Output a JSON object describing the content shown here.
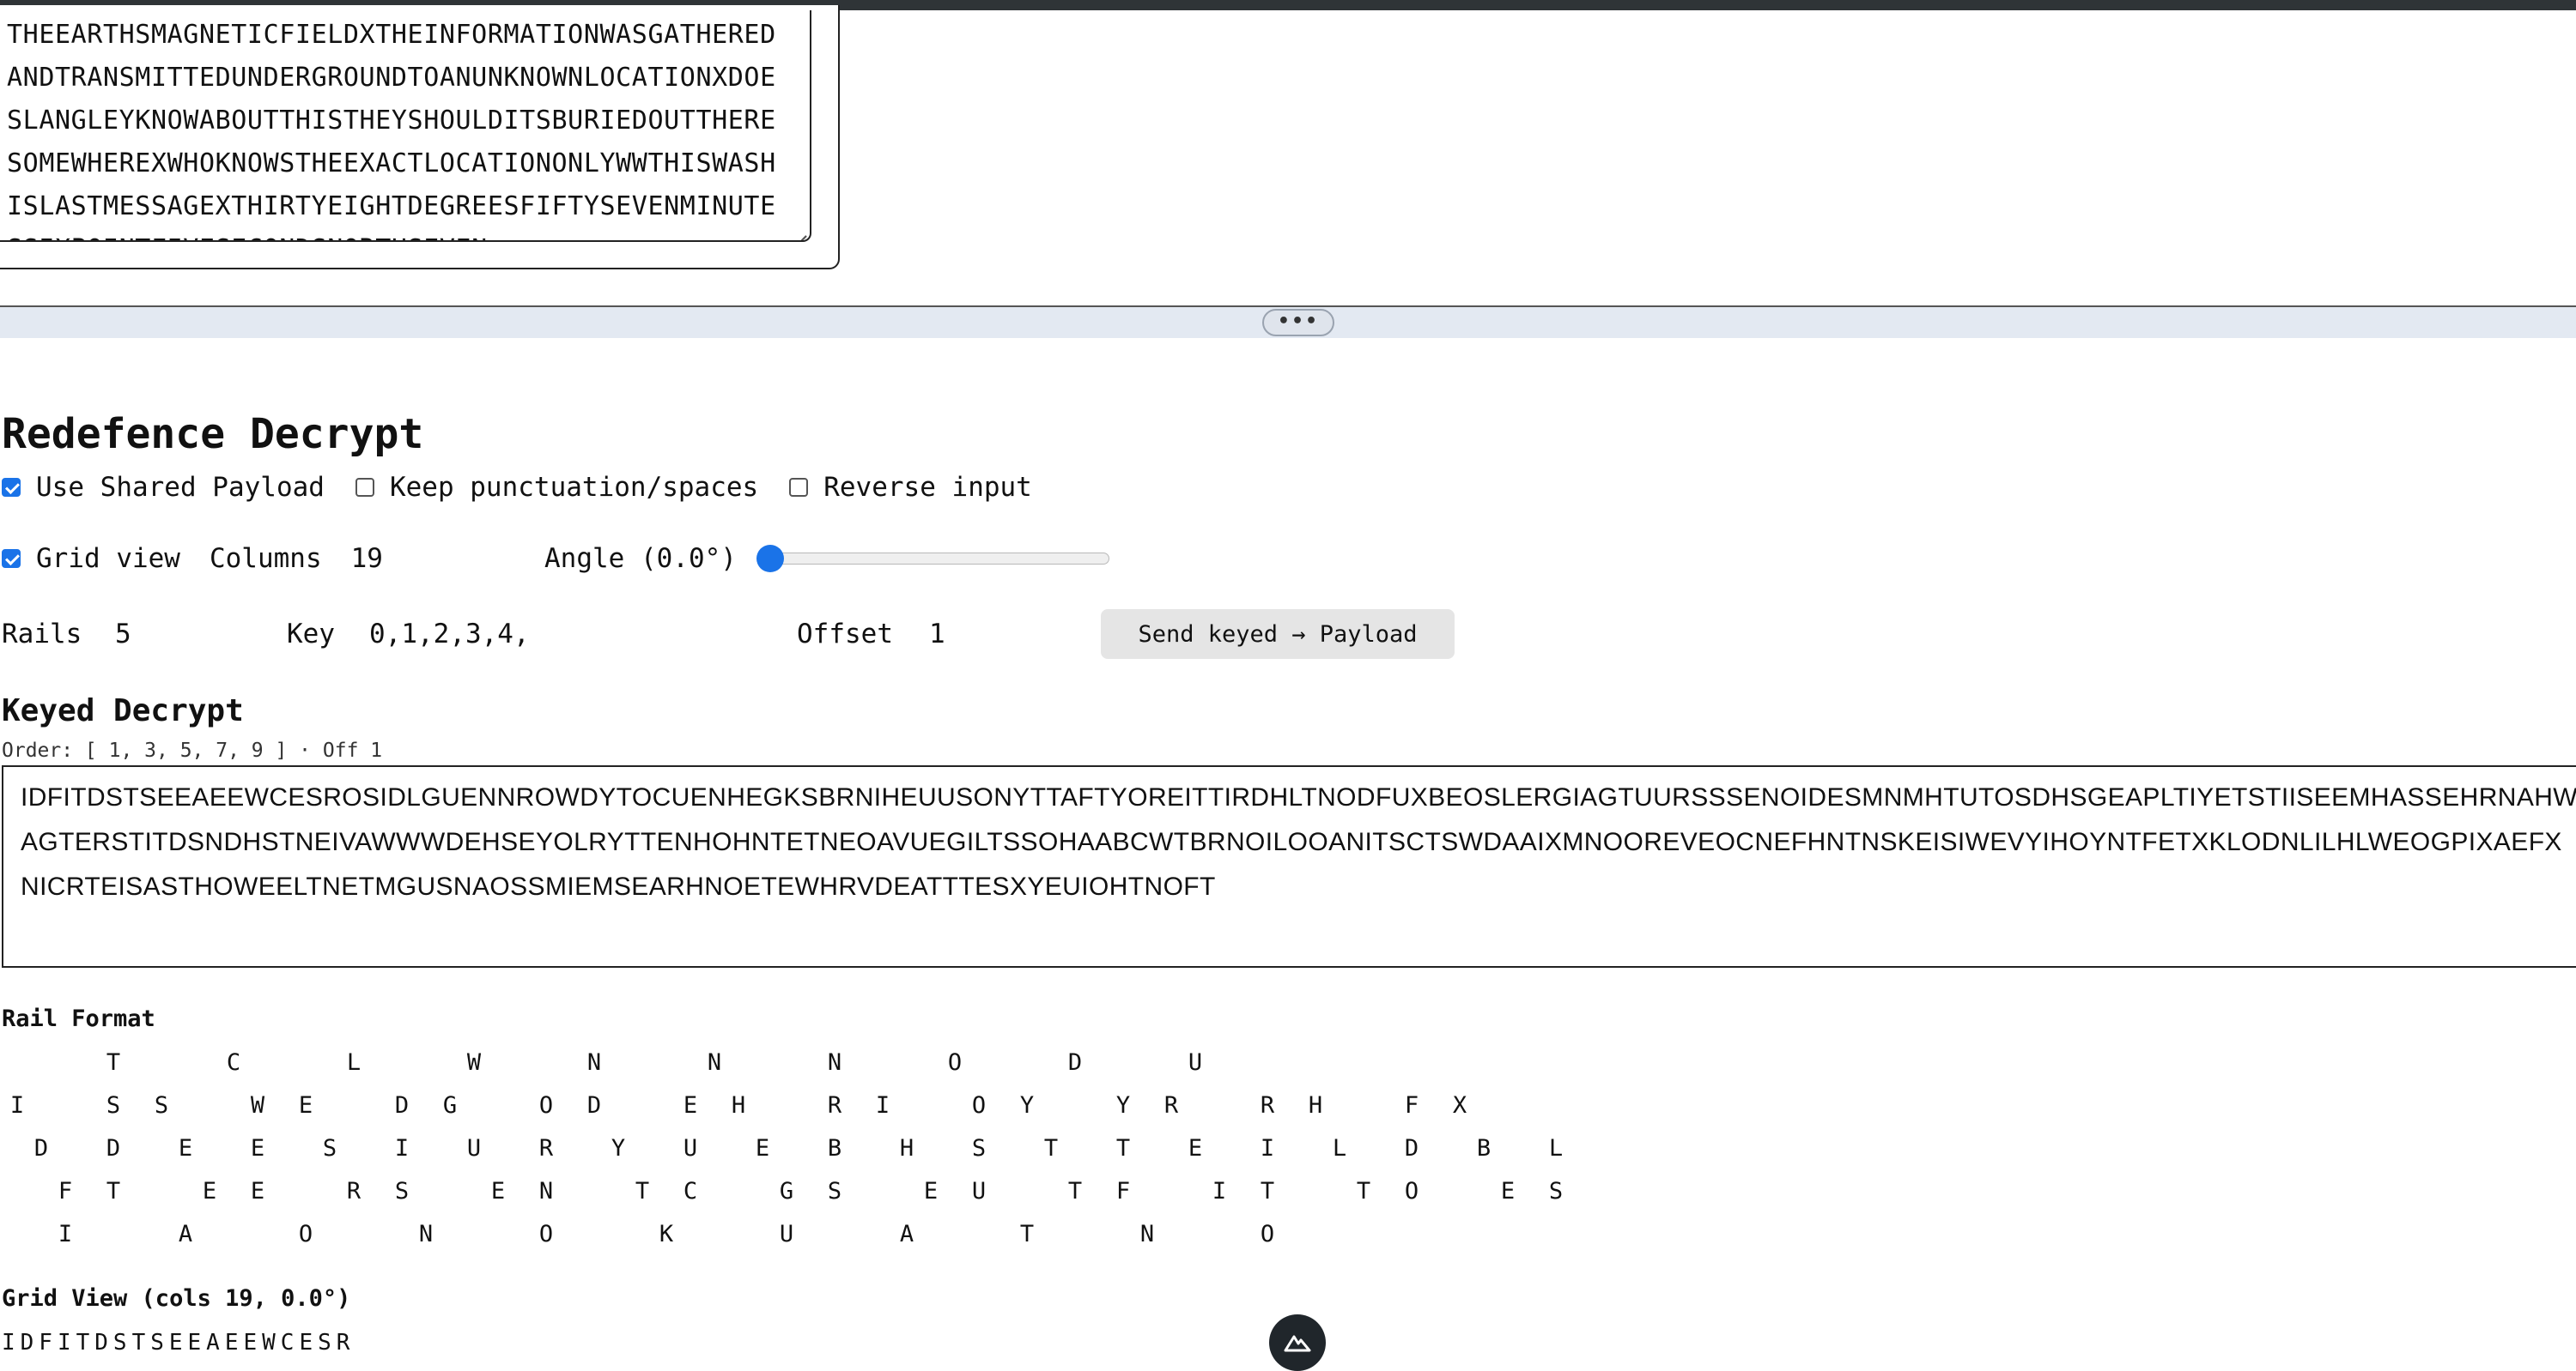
{
  "top_textarea": {
    "text": "THEEARTHSMAGNETICFIELDXTHEINFORMATIONWASGATHEREDANDTRANSMITTEDUNDERGROUNDTOANUNKNOWNLOCATIONXDOESLANGLEYKNOWABOUTTHISTHEYSHOULDITSBURIEDOUTTHERESOMEWHEREXWHOKNOWSTHEEXACTLOCATIONONLYWWTHISWASHISLASTMESSAGEXTHIRTYEIGHTDEGREESFIFTYSEVENMINUTESSIXPOINTFIVESECONDSNORTHSEVEN"
  },
  "splitter": {
    "grip": "•••"
  },
  "panel": {
    "title": "Redefence Decrypt",
    "options": {
      "use_shared_payload": {
        "label": "Use Shared Payload",
        "checked": true
      },
      "keep_punctuation": {
        "label": "Keep punctuation/spaces",
        "checked": false
      },
      "reverse_input": {
        "label": "Reverse input",
        "checked": false
      }
    },
    "grid_view": {
      "label": "Grid view",
      "checked": true
    },
    "columns": {
      "label": "Columns",
      "value": "19"
    },
    "angle": {
      "label": "Angle (0.0°)",
      "value": 0
    },
    "rails": {
      "label": "Rails",
      "value": "5"
    },
    "key": {
      "label": "Key",
      "value": "0,1,2,3,4,"
    },
    "offset": {
      "label": "Offset",
      "value": "1"
    },
    "send_button": "Send keyed → Payload"
  },
  "keyed": {
    "title": "Keyed Decrypt",
    "order": "Order: [ 1, 3, 5, 7, 9 ] · Off 1",
    "output": "IDFITDSTSEEAEEWCESROSIDLGUENNROWDYTOCUENHEGKSBRNIHEUUSONYTTAFTYOREITTIRDHLTNODFUXBEOSLERGIAGTUURSSSENOIDESMNMHTUTOSDHSGEAPLTIYETSTIISEEMHASSEHRNAHWAGTERSTITDSNDHSTNEIVAWWWDEHSEYOLRYTTENHOHNTETNEOAVUEGILTSSOHAABCWTBRNOILOOANITSCTSWDAAIXMNOOREVEOCNEFHNTNSKEISIWEVYIHOYNTFETXKLODNLILHLWEOGPIXAEFXNICRTEISASTHOWEELTNETMGUSNAOSSMIEMSEARHNOETEWHRVDEATTTESXYEUIOHTNOFT"
  },
  "rail_format": {
    "label": "Rail Format",
    "rows": [
      "    T    C    L    W    N    N    N    O    D    U",
      "I   S S   W E   D G   O D   E H   R I   O Y   Y R   R H   F X",
      " D  D  E  E  S  I  U  R  Y  U  E  B  H  S  T  T  E  I  L  D  B  L",
      "  F T   E E   R S   E N   T C   G S   E U   T F   I T   T O   E S",
      "  I    A    O    N    O    K    U    A    T    N    O"
    ]
  },
  "grid_view": {
    "label": "Grid View (cols 19, 0.0°)",
    "first_row": "IDFITDSTSEEAEEWCESR"
  }
}
